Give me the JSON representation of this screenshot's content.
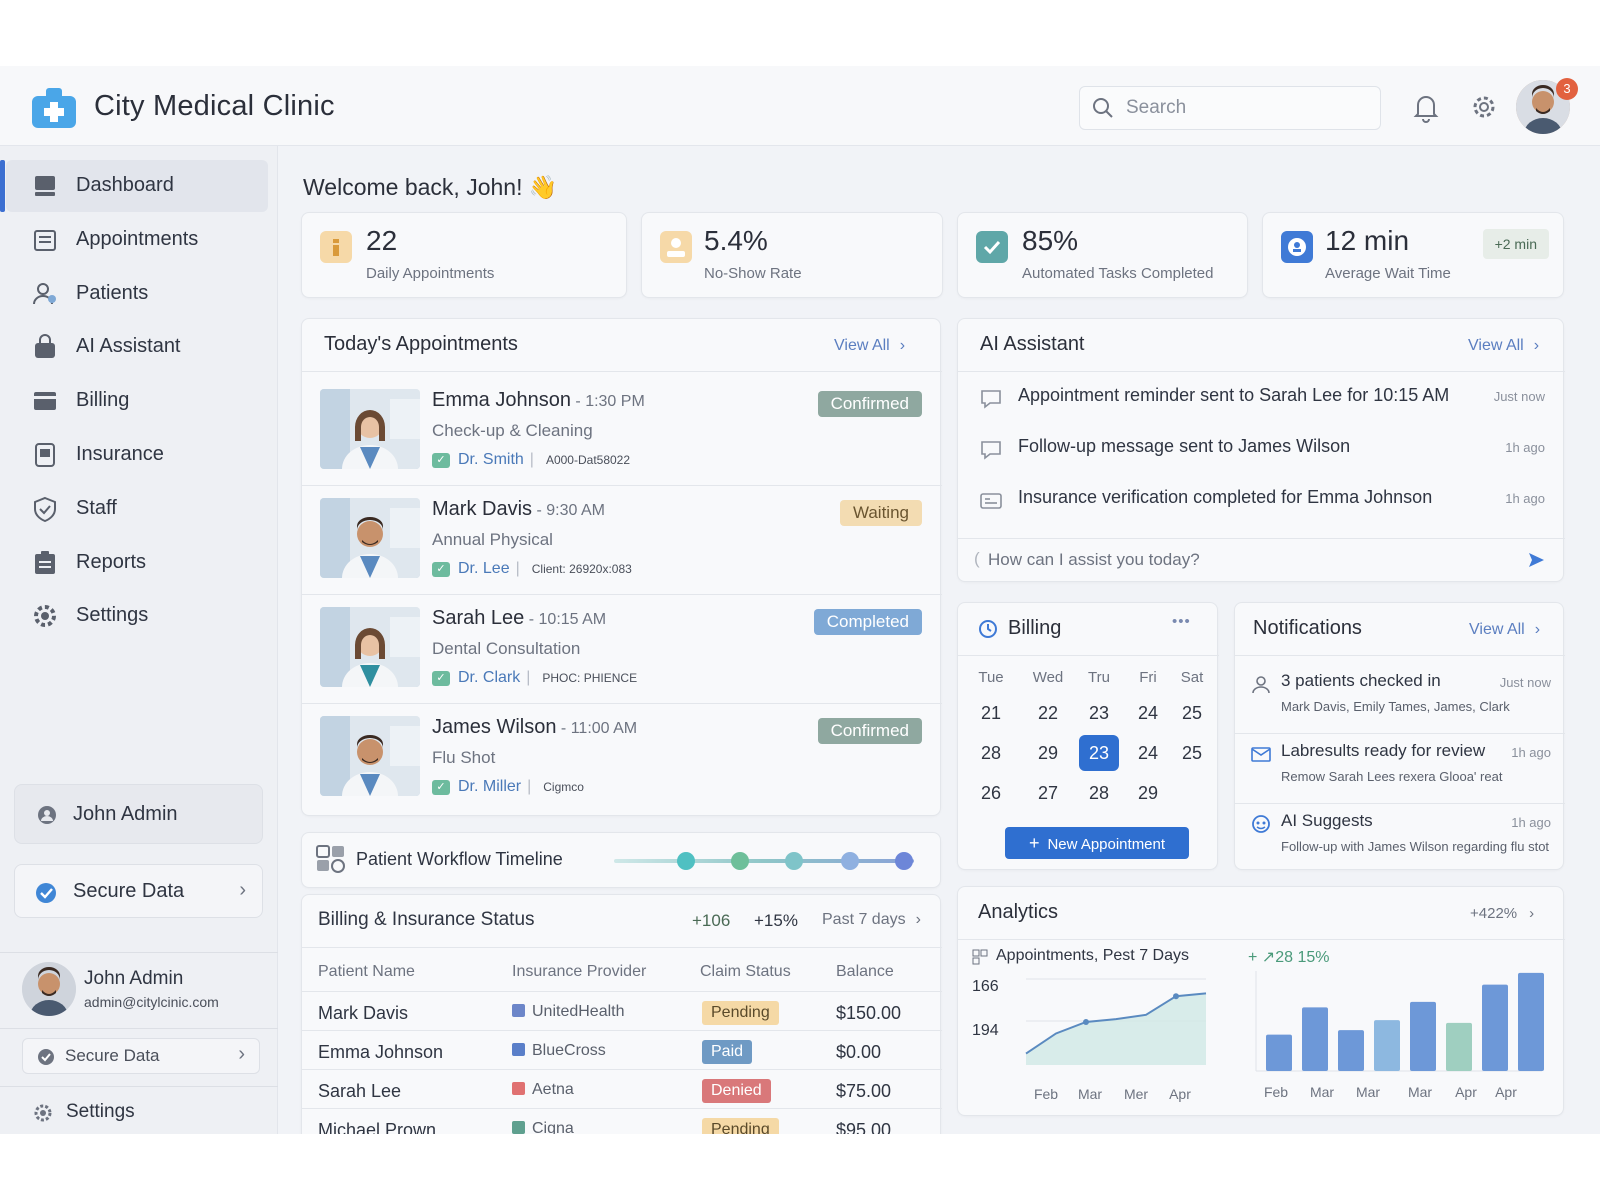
{
  "header": {
    "title": "City Medical Clinic",
    "search_placeholder": "Search",
    "notification_count": "3"
  },
  "sidebar": {
    "items": [
      {
        "label": "Dashboard",
        "icon": "dashboard-icon",
        "active": true
      },
      {
        "label": "Appointments",
        "icon": "calendar-list-icon"
      },
      {
        "label": "Patients",
        "icon": "patients-icon"
      },
      {
        "label": "AI Assistant",
        "icon": "ai-bag-icon"
      },
      {
        "label": "Billing",
        "icon": "billing-icon"
      },
      {
        "label": "Insurance",
        "icon": "insurance-icon"
      },
      {
        "label": "Staff",
        "icon": "shield-icon"
      },
      {
        "label": "Reports",
        "icon": "clipboard-icon"
      },
      {
        "label": "Settings",
        "icon": "gear-icon"
      }
    ],
    "user_box_label": "John Admin",
    "secure_box_label": "Secure Data",
    "profile": {
      "name": "John Admin",
      "email": "admin@citylcinic.com"
    },
    "secure_label_2": "Secure Data",
    "settings_label": "Settings"
  },
  "welcome": "Welcome back, John! 👋",
  "stats": [
    {
      "value": "22",
      "label": "Daily Appointments",
      "icon": "info-icon",
      "color": "#f2c27a"
    },
    {
      "value": "5.4%",
      "label": "No-Show Rate",
      "icon": "warning-person-icon",
      "color": "#f2c27a"
    },
    {
      "value": "85%",
      "label": "Automated Tasks Completed",
      "icon": "check-shield-icon",
      "color": "#5fa7a8"
    },
    {
      "value": "12 min",
      "label": "Average Wait Time",
      "icon": "clock-person-icon",
      "color": "#3f7ad6",
      "delta": "+2 min"
    }
  ],
  "appointments": {
    "title": "Today's Appointments",
    "view_all": "View All",
    "items": [
      {
        "name": "Emma Johnson",
        "time": " - 1:30 PM",
        "type": "Check-up & Cleaning",
        "doctor": "Dr. Smith",
        "code": "A000-Dat58022",
        "status": "Confirmed",
        "status_color": "#8fa8a0"
      },
      {
        "name": "Mark Davis",
        "time": " - 9:30 AM",
        "type": "Annual Physical",
        "doctor": "Dr. Lee",
        "code": "Client: 26920x:083",
        "status": "Waiting",
        "status_color": "#f3dcb2"
      },
      {
        "name": "Sarah Lee",
        "time": " - 10:15 AM",
        "type": "Dental Consultation",
        "doctor": "Dr. Clark",
        "code": "PHOC: PHIENCE",
        "status": "Completed",
        "status_color": "#7fa9d6"
      },
      {
        "name": "James Wilson",
        "time": " - 11:00 AM",
        "type": "Flu Shot",
        "doctor": "Dr. Miller",
        "code": "Cigmco",
        "status": "Confirmed",
        "status_color": "#8fa8a0"
      }
    ]
  },
  "ai_assistant": {
    "title": "AI Assistant",
    "view_all": "View All",
    "messages": [
      {
        "text": "Appointment reminder sent to Sarah Lee for 10:15 AM",
        "time": "Just now",
        "icon": "chat-icon"
      },
      {
        "text": "Follow-up message sent to James Wilson",
        "time": "1h ago",
        "icon": "chat-icon"
      },
      {
        "text": "Insurance verification completed for Emma Johnson",
        "time": "1h ago",
        "icon": "id-card-icon"
      }
    ],
    "input_placeholder": "How can I assist you today?"
  },
  "billing_calendar": {
    "title": "Billing",
    "more": "•••",
    "weekdays": [
      "Tue",
      "Wed",
      "Tru",
      "Fri",
      "Sat"
    ],
    "weeks": [
      [
        "21",
        "22",
        "23",
        "24",
        "25"
      ],
      [
        "28",
        "29",
        "23",
        "24",
        "25"
      ],
      [
        "26",
        "27",
        "28",
        "29",
        ""
      ]
    ],
    "selected": "23",
    "button": "New Appointment"
  },
  "notifications": {
    "title": "Notifications",
    "view_all": "View All",
    "items": [
      {
        "title": "3 patients checked in",
        "sub": "Mark Davis, Emily Tames, James, Clark",
        "time": "Just now",
        "icon": "person-icon"
      },
      {
        "title": "Labresults ready for review",
        "sub": "Remow Sarah Lees rexera Glooa' reat",
        "time": "1h ago",
        "icon": "mail-icon"
      },
      {
        "title": "AI Suggests",
        "sub": "Follow-up with James Wilson regarding flu stot",
        "time": "1h ago",
        "icon": "ai-face-icon"
      }
    ]
  },
  "workflow": {
    "title": "Patient Workflow Timeline",
    "dots": [
      "#4fc0c2",
      "#6ebf9a",
      "#7fc4c9",
      "#8fb0e0",
      "#6d86d8"
    ]
  },
  "billing_status": {
    "title": "Billing & Insurance Status",
    "stat1": "+106",
    "stat2": "+15%",
    "period": "Past 7 days",
    "headers": [
      "Patient Name",
      "Insurance Provider",
      "Claim Status",
      "Balance"
    ],
    "rows": [
      {
        "name": "Mark Davis",
        "provider": "UnitedHealth",
        "provider_color": "#6c86c9",
        "status": "Pending",
        "status_bg": "#f5d9a6",
        "status_fg": "#5a4a2a",
        "balance": "$150.00"
      },
      {
        "name": "Emma Johnson",
        "provider": "BlueCross",
        "provider_color": "#5a7fc9",
        "status": "Paid",
        "status_bg": "#6f9ac4",
        "status_fg": "#ffffff",
        "balance": "$0.00"
      },
      {
        "name": "Sarah Lee",
        "provider": "Aetna",
        "provider_color": "#e07171",
        "status": "Denied",
        "status_bg": "#d9787a",
        "status_fg": "#ffffff",
        "balance": "$75.00"
      },
      {
        "name": "Michael Prown",
        "provider": "Cigna",
        "provider_color": "#5fa08f",
        "status": "Pending",
        "status_bg": "#f5d9a6",
        "status_fg": "#5a4a2a",
        "balance": "$95.00"
      }
    ]
  },
  "analytics": {
    "title": "Analytics",
    "delta": "+422%",
    "line_title": "Appointments, Pest 7 Days",
    "bar_title": "+ ↗28 15%"
  },
  "chart_data": [
    {
      "type": "area",
      "title": "Appointments, Pest 7 Days",
      "yticks": [
        "166",
        "194"
      ],
      "categories": [
        "Feb",
        "Mar",
        "Mer",
        "Apr"
      ],
      "values": [
        148,
        162,
        170,
        172,
        175,
        188,
        190
      ]
    },
    {
      "type": "bar",
      "categories": [
        "Feb",
        "Mar",
        "Mar",
        "Mar",
        "Apr",
        "Apr"
      ],
      "values": [
        40,
        70,
        45,
        56,
        76,
        53,
        95,
        108
      ],
      "colors": [
        "#6d98d8",
        "#6d98d8",
        "#6d98d8",
        "#8db8e0",
        "#6d98d8",
        "#9fcfc0",
        "#6d98d8",
        "#6d98d8"
      ]
    }
  ]
}
